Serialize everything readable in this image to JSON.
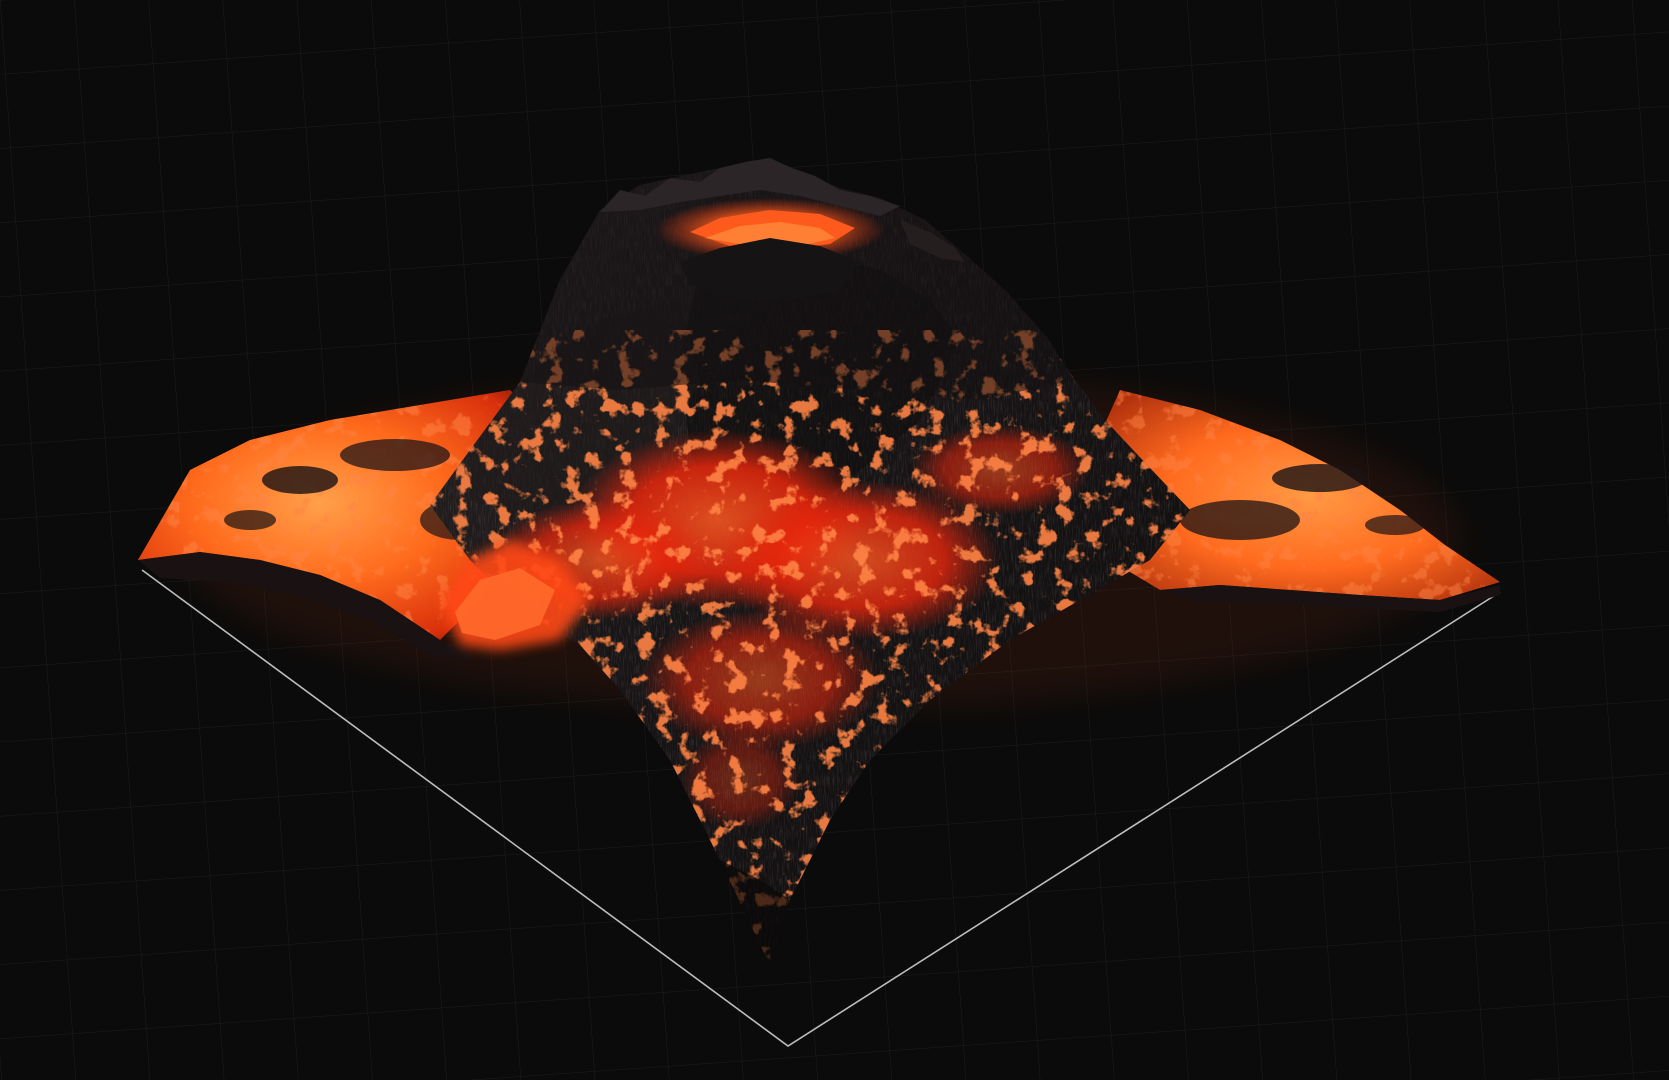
{
  "viewport": {
    "background_color": "#0b0b0b",
    "grid_color": "#1c1c1c",
    "bounds_outline_color": "#bdbdbd"
  },
  "terrain": {
    "rock_color": "#141213",
    "rock_highlight_color": "#2a2324",
    "lava_bright_color": "#ff7a22",
    "lava_core_color": "#ff3a10",
    "lava_deep_color": "#c41d08",
    "glow_color": "#ff5a14"
  }
}
